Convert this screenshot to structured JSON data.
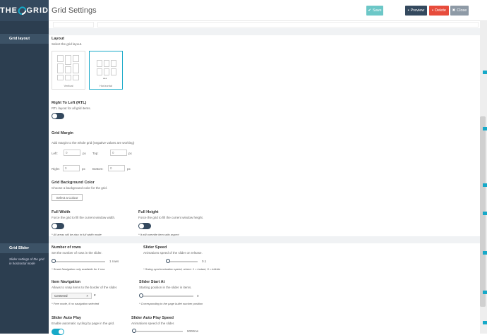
{
  "app": {
    "logo_left": "THE",
    "logo_right": "GRID",
    "page_title": "Grid Settings"
  },
  "toolbar": {
    "save": "Save",
    "preview": "Preview",
    "delete": "Delete",
    "close": "Close"
  },
  "sidebar": {
    "sections": [
      {
        "label": "Grid layout"
      },
      {
        "label": "Grid Slider",
        "subtitle": "Slider settings of the grid in horizontal mode"
      }
    ]
  },
  "layout": {
    "label": "Layout",
    "desc": "Select the grid layout.",
    "options": [
      {
        "label": "Vertical"
      },
      {
        "label": "Horizontal"
      }
    ]
  },
  "rtl": {
    "label": "Right To Left (RTL)",
    "desc": "RTL layout for all grid items."
  },
  "margin": {
    "label": "Grid Margin",
    "desc": "Add margin to the whole grid (negative values are working)",
    "left": "Left:",
    "top": "Top:",
    "right": "Right:",
    "bottom": "Bottom:",
    "unit": "px",
    "left_val": "0",
    "top_val": "0",
    "right_val": "0",
    "bottom_val": "0"
  },
  "bg": {
    "label": "Grid Background Color",
    "desc": "Choose a background color for the grid.",
    "button": "Select a Colour"
  },
  "full_width": {
    "label": "Full Width",
    "desc": "Force the grid to fill the current window width.",
    "note": "* All areas will be also in full width mode"
  },
  "full_height": {
    "label": "Full Height",
    "desc": "Force the grid to fill the current window height.",
    "note": "* It will override item ratio aspect"
  },
  "rows": {
    "label": "Number of rows",
    "desc": "Set the number of rows in the slider.",
    "value": "1 rows",
    "note": "* Smart Navigation only available for 1 row"
  },
  "speed": {
    "label": "Slider Speed",
    "desc": "Animations speed of the slider on release.",
    "value": "0.1",
    "note": "* Swing synchronization speed, where: 1 = instant, 0 = infinite"
  },
  "item_nav": {
    "label": "Item Navigation",
    "desc": "Allows to snap items to the border of the slider.",
    "selected": "Centered",
    "note": "* Free mode, if no navigation selected"
  },
  "start_at": {
    "label": "Slider Start At",
    "desc": "Starting position in the slider in items.",
    "value": "0",
    "note": "* Corresponding to the page bullet number position"
  },
  "autoplay": {
    "label": "Slider Auto Play",
    "desc": "Enable automatic cycling by page in the grid."
  },
  "autoplay_speed": {
    "label": "Slider Auto Play Speed",
    "desc": "Animations speed of the slider.",
    "value": "5000ms"
  },
  "colors": {
    "accent": "#16a9c8",
    "dark": "#34495e",
    "sidebar": "#2c3e50",
    "save": "#6cc7c7",
    "delete": "#e74c3c",
    "close": "#8e9aa6"
  }
}
